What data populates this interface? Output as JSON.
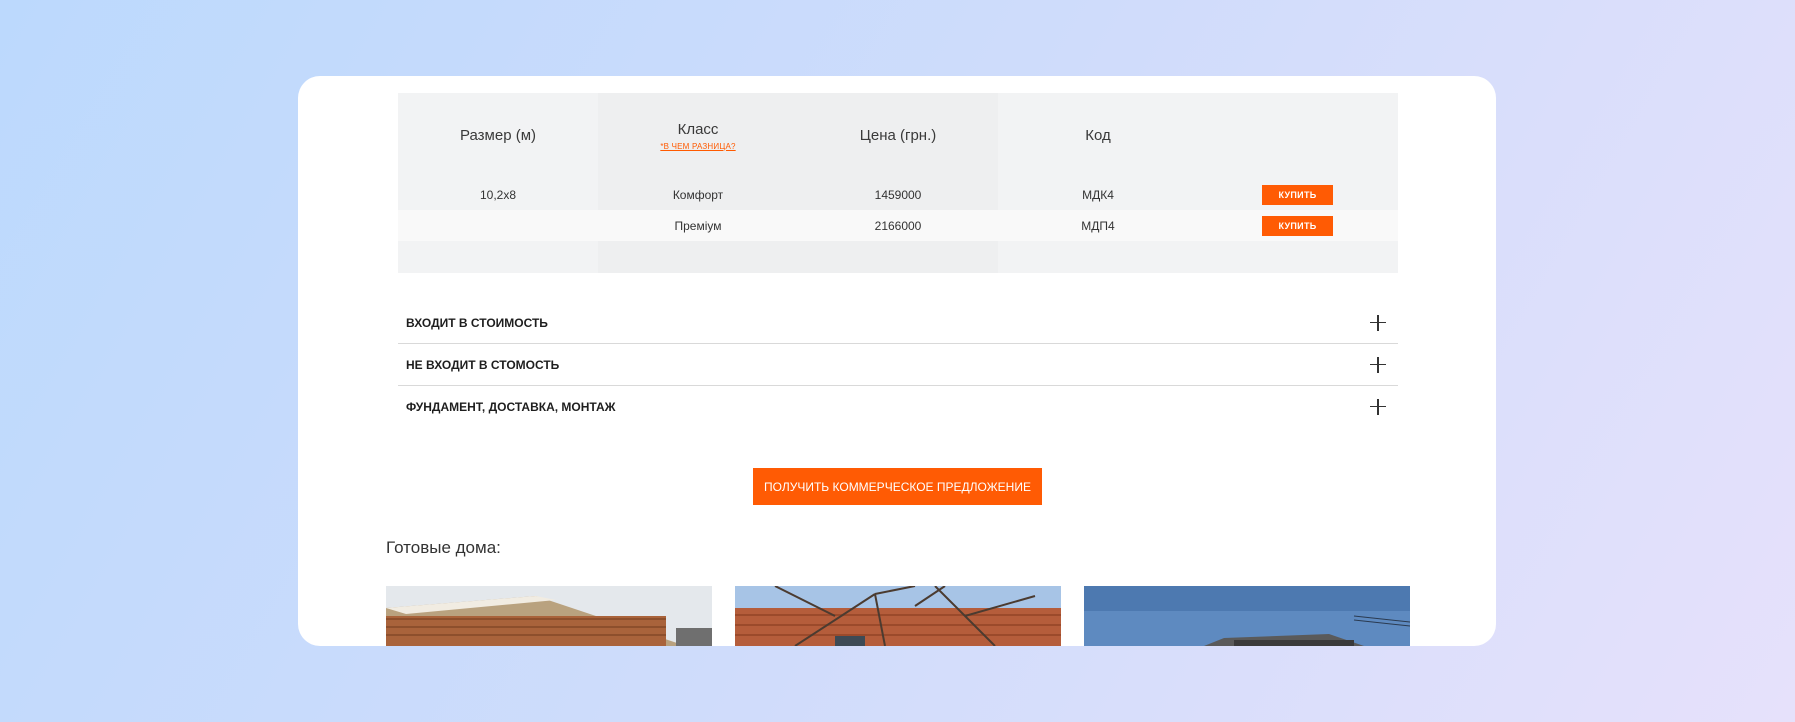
{
  "table": {
    "headers": {
      "size": "Размер (м)",
      "class": "Класс",
      "class_hint": "*В ЧЕМ РАЗНИЦА?",
      "price": "Цена (грн.)",
      "code": "Код"
    },
    "rows": [
      {
        "size": "10,2x8",
        "class": "Комфорт",
        "price": "1459000",
        "code": "МДК4",
        "buy": "КУПИТЬ"
      },
      {
        "size": "",
        "class": "Преміум",
        "price": "2166000",
        "code": "МДП4",
        "buy": "КУПИТЬ"
      }
    ]
  },
  "accordion": [
    {
      "label": "ВХОДИТ В СТОИМОСТЬ",
      "icon": "plus-icon"
    },
    {
      "label": "НЕ ВХОДИТ В СТОМОСТЬ",
      "icon": "plus-icon"
    },
    {
      "label": "ФУНДАМЕНТ, ДОСТАВКА, МОНТАЖ",
      "icon": "plus-icon"
    }
  ],
  "offer_button": "ПОЛУЧИТЬ КОММЕРЧЕСКОЕ ПРЕДЛОЖЕНИЕ",
  "ready_houses": {
    "title": "Готовые дома:"
  },
  "colors": {
    "accent": "#ff5b04",
    "table_bg": "#f2f3f4"
  }
}
